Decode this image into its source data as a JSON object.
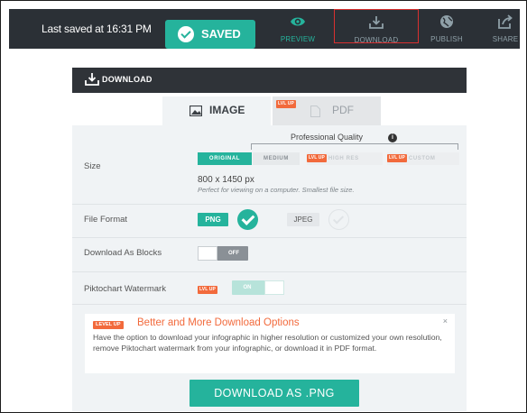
{
  "topbar": {
    "last_saved": "Last saved at 16:31 PM",
    "saved_label": "SAVED",
    "tools": {
      "preview": "PREVIEW",
      "download": "DOWNLOAD",
      "publish": "PUBLISH",
      "share": "SHARE"
    },
    "icons": [
      "eye-icon",
      "download-icon",
      "globe-icon",
      "share-icon"
    ],
    "accent_color": "#25b39c",
    "highlight_color": "#d93030"
  },
  "panel": {
    "title": "DOWNLOAD",
    "tabs": {
      "image": "IMAGE",
      "pdf": "PDF",
      "pdf_badge": "LVL UP"
    },
    "size": {
      "label": "Size",
      "quality_label": "Professional Quality",
      "options": {
        "original": "ORIGINAL",
        "medium": "MEDIUM",
        "high_res": "HIGH RES",
        "custom": "CUSTOM",
        "lvl_badge": "LVL UP"
      },
      "selected": "ORIGINAL",
      "dimensions": "800 x 1450 px",
      "note": "Perfect for viewing on a computer. Smallest file size."
    },
    "file_format": {
      "label": "File Format",
      "png": "PNG",
      "jpeg": "JPEG",
      "selected": "PNG"
    },
    "download_as_blocks": {
      "label": "Download As Blocks",
      "state": "OFF"
    },
    "watermark": {
      "label": "Piktochart Watermark",
      "badge": "LVL UP",
      "state": "ON"
    },
    "promo": {
      "badge": "LEVEL UP",
      "title": "Better and More Download Options",
      "close": "×",
      "text": "Have the option to download your infographic in higher resolution or customized your own resolution, remove Piktochart watermark from your infographic, or download it in PDF format."
    },
    "download_button": "DOWNLOAD AS .PNG",
    "colors": {
      "badge": "#f26a3c",
      "green": "#25b39c"
    }
  }
}
